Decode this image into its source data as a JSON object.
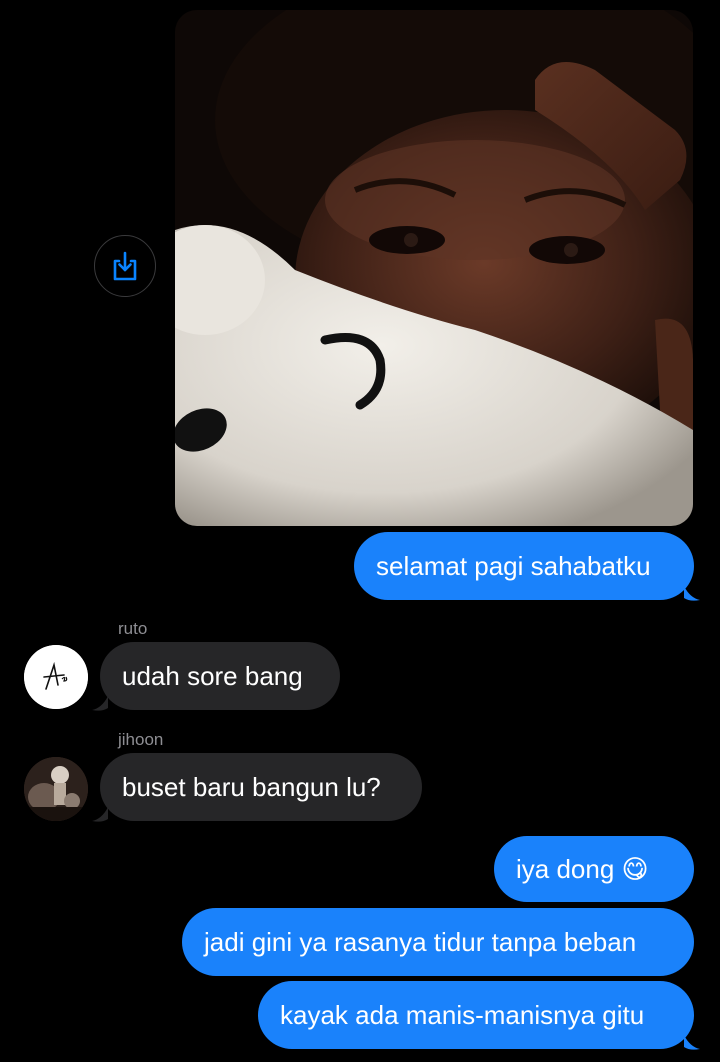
{
  "chat": {
    "messages": [
      {
        "type": "photo",
        "direction": "outgoing",
        "save_icon": "save-to-device-icon"
      },
      {
        "type": "text",
        "direction": "outgoing",
        "text": "selamat pagi sahabatku"
      },
      {
        "type": "text",
        "direction": "incoming",
        "sender": "ruto",
        "text": "udah sore bang"
      },
      {
        "type": "text",
        "direction": "incoming",
        "sender": "jihoon",
        "text": "buset baru bangun lu?"
      },
      {
        "type": "text",
        "direction": "outgoing",
        "text": "iya dong 😋"
      },
      {
        "type": "text",
        "direction": "outgoing",
        "text": "jadi gini ya rasanya tidur tanpa beban"
      },
      {
        "type": "text",
        "direction": "outgoing",
        "text": "kayak ada manis-manisnya gitu"
      }
    ]
  },
  "colors": {
    "background": "#000000",
    "outgoing_bubble": "#1a82fb",
    "incoming_bubble": "#262628",
    "sender_name": "#8e8e93",
    "accent_icon": "#0a84ff"
  }
}
